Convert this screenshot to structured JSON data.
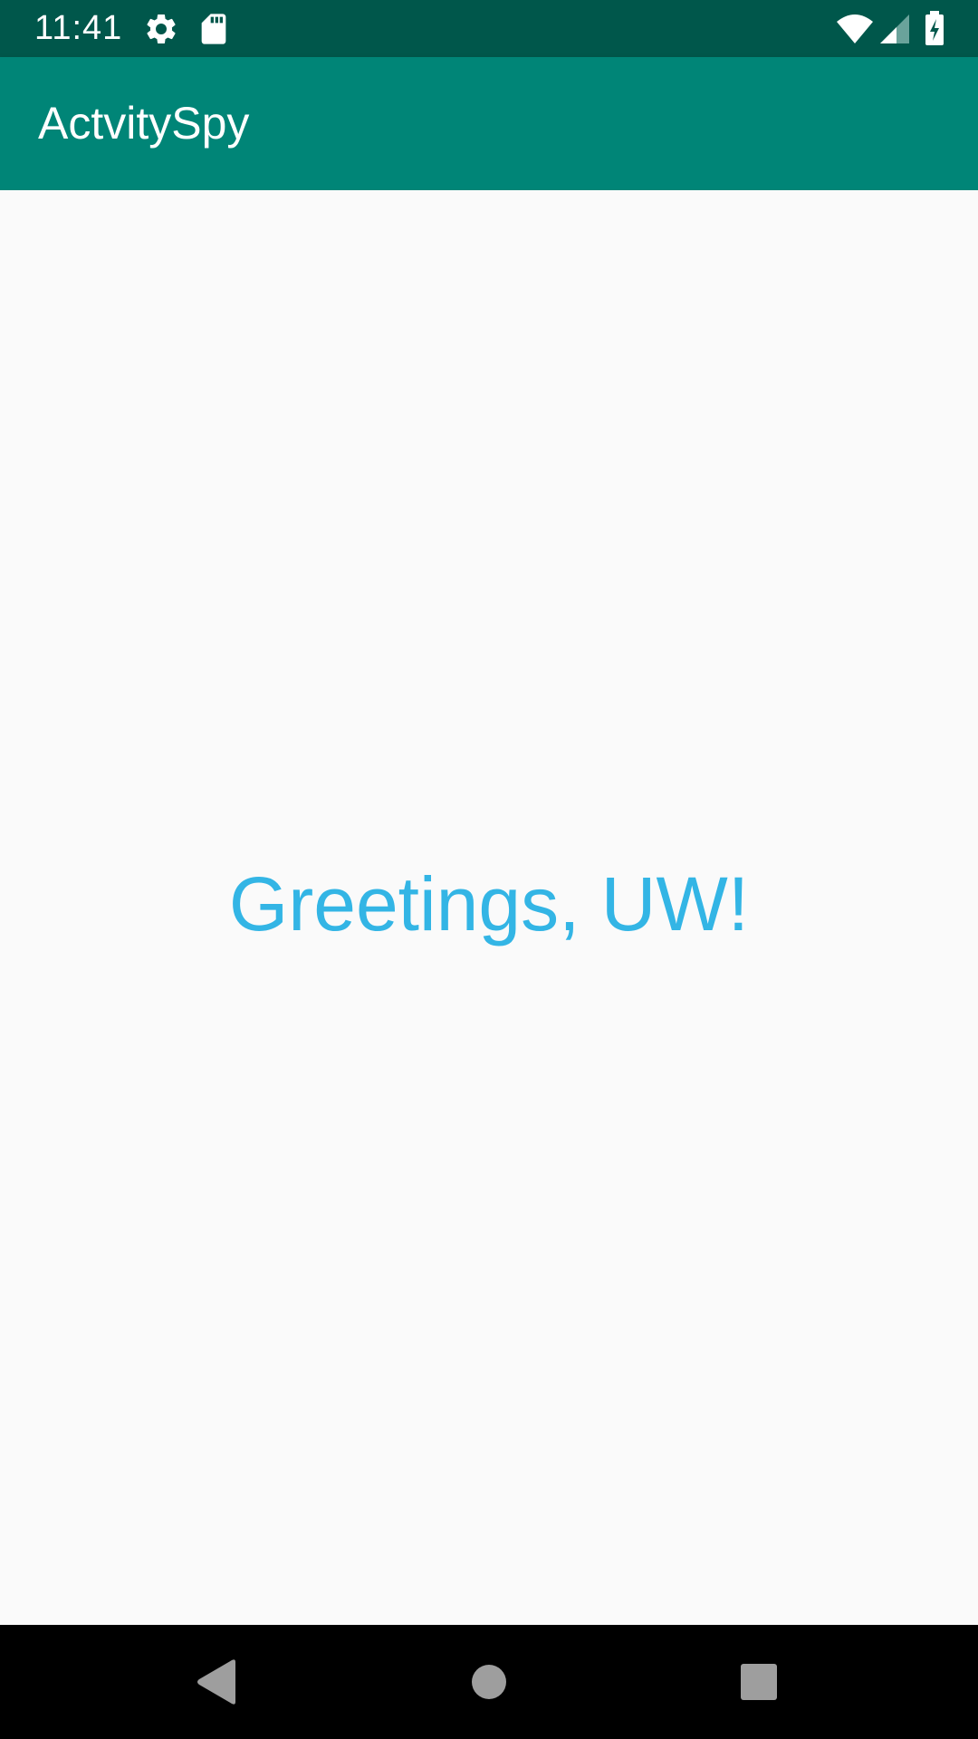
{
  "status_bar": {
    "time": "11:41",
    "icons": [
      "gear-icon",
      "sd-card-icon",
      "wifi-icon",
      "cell-signal-icon",
      "battery-charging-icon"
    ],
    "background": "#00574b"
  },
  "app_bar": {
    "title": "ActvitySpy",
    "background": "#008577"
  },
  "main": {
    "greeting": "Greetings, UW!",
    "greeting_color": "#33b5e5"
  },
  "nav_bar": {
    "buttons": [
      "back-icon",
      "home-icon",
      "recents-icon"
    ],
    "icon_color": "#9e9e9e"
  }
}
